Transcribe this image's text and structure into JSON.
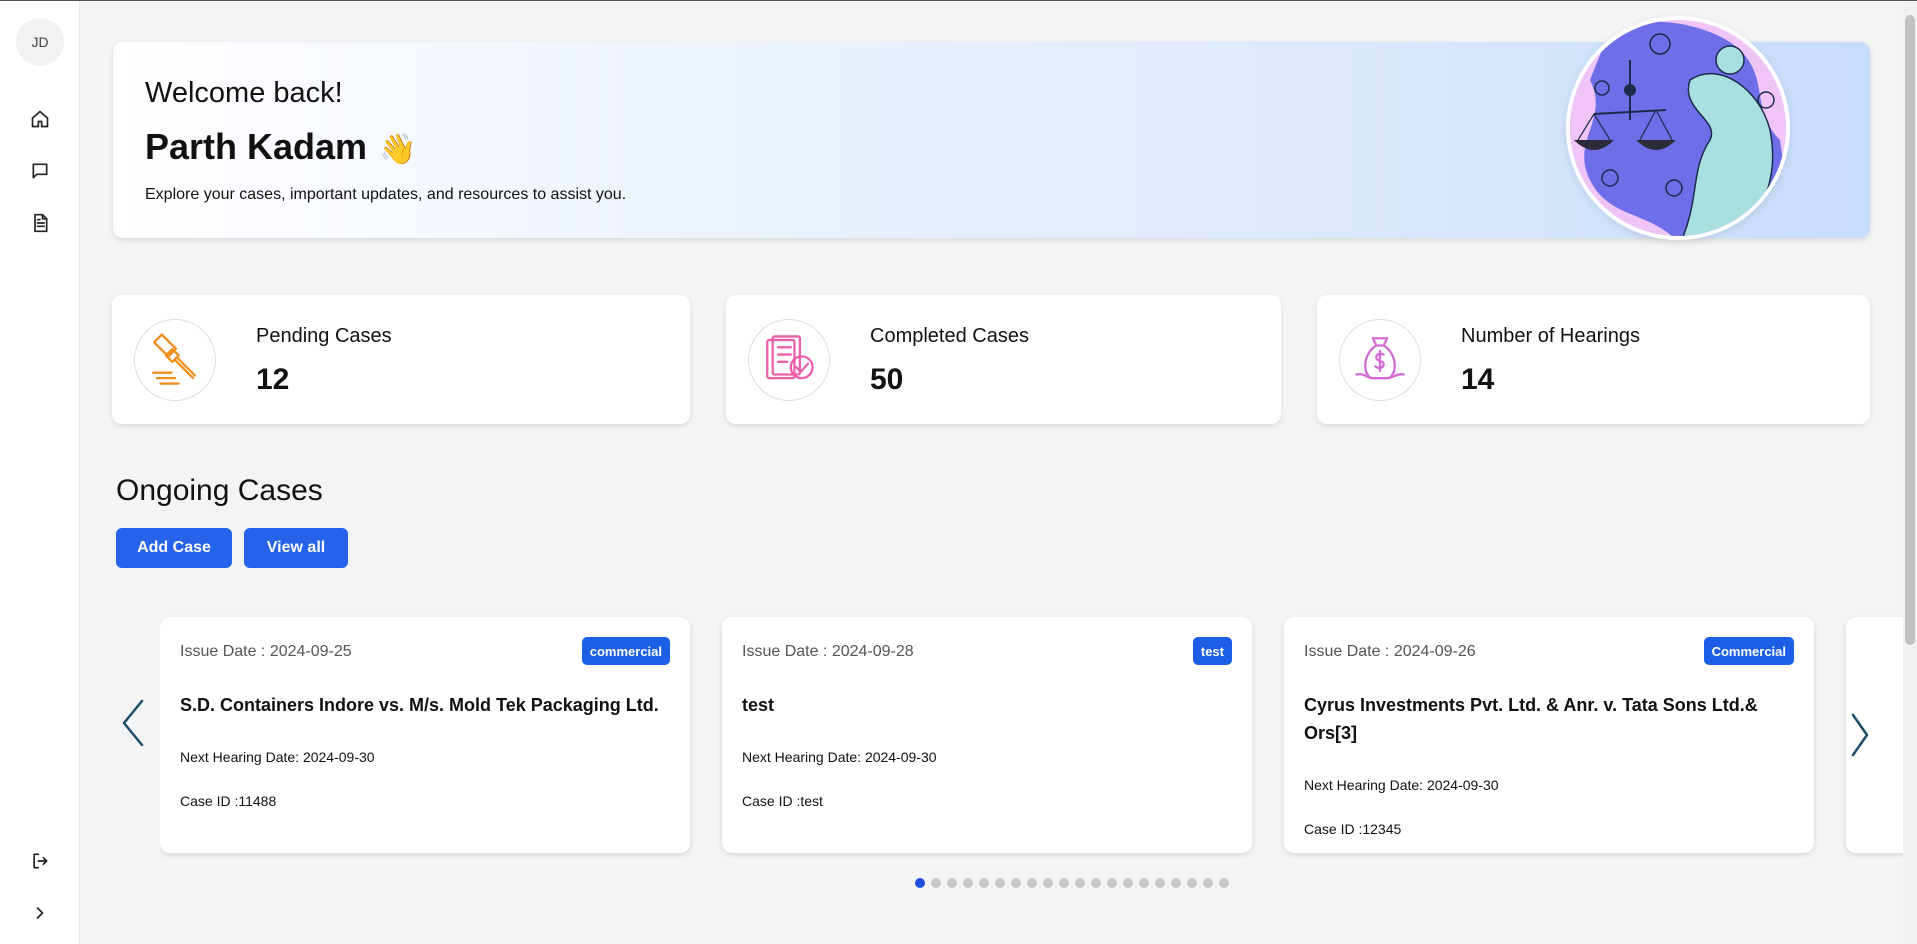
{
  "sidebar": {
    "avatar_initials": "JD",
    "items": [
      {
        "icon": "home-icon"
      },
      {
        "icon": "chat-icon"
      },
      {
        "icon": "document-icon"
      }
    ],
    "logout_icon": "logout-icon",
    "expand_icon": "chevron-right-icon"
  },
  "hero": {
    "greeting": "Welcome back!",
    "name": "Parth Kadam",
    "wave": "👋",
    "description": "Explore your cases, important updates, and resources to assist you."
  },
  "stats": [
    {
      "label": "Pending Cases",
      "value": "12",
      "icon": "gavel-icon",
      "color": "#f28c1b"
    },
    {
      "label": "Completed Cases",
      "value": "50",
      "icon": "clipboard-check-icon",
      "color": "#ec5fa8"
    },
    {
      "label": "Number of Hearings",
      "value": "14",
      "icon": "money-bag-icon",
      "color": "#d46ad8"
    }
  ],
  "ongoing": {
    "title": "Ongoing Cases",
    "add_label": "Add Case",
    "view_label": "View all"
  },
  "cases": [
    {
      "issue_date": "Issue Date : 2024-09-25",
      "tag": "commercial",
      "title": "S.D. Containers Indore vs. M/s. Mold Tek Packaging Ltd.",
      "next_hearing": "Next Hearing Date: 2024-09-30",
      "case_id": "Case ID :11488"
    },
    {
      "issue_date": "Issue Date : 2024-09-28",
      "tag": "test",
      "title": "test",
      "next_hearing": "Next Hearing Date: 2024-09-30",
      "case_id": "Case ID :test"
    },
    {
      "issue_date": "Issue Date : 2024-09-26",
      "tag": "Commercial",
      "title": "Cyrus Investments Pvt. Ltd. & Anr. v. Tata Sons Ltd.& Ors[3]",
      "next_hearing": "Next Hearing Date: 2024-09-30",
      "case_id": "Case ID :12345"
    }
  ],
  "carousel": {
    "dot_count": 20,
    "active_index": 0,
    "prev_icon": "chevron-left-icon",
    "next_icon": "chevron-right-icon"
  },
  "colors": {
    "primary": "#2563eb",
    "tag": "#1d5ee6",
    "arrow": "#1e4d6b"
  }
}
